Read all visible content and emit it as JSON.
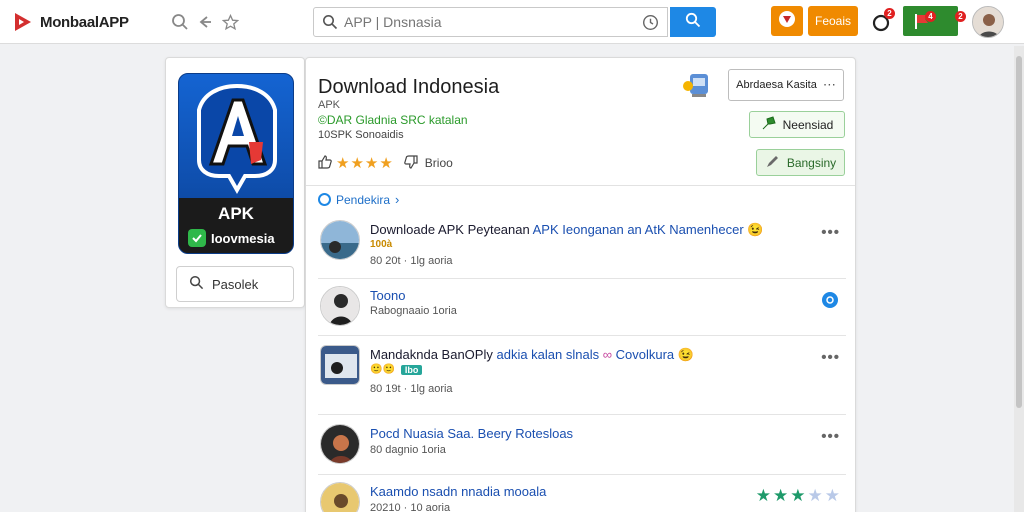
{
  "header": {
    "logo_text": "MonbaalAPP",
    "search_placeholder": "APP | Dnsnasia",
    "orange_button_label": "Feoais",
    "green_badge_count": "4",
    "ring_badge_count": "2",
    "green_badge_count_2": "2"
  },
  "app_card": {
    "icon_label": "APK",
    "icon_sublabel": "Ioovmesia",
    "search_button_label": "Pasolek"
  },
  "app_details": {
    "title": "Download Indonesia",
    "subtitle1": "APK",
    "subtitle2": "©DAR Gladnia SRC katalan",
    "subtitle3": "10SPK Sonoaidis",
    "rating_text": "Brioo",
    "rating_value": 4,
    "actions": {
      "outline_button_label": "Abrdaesa Kasita",
      "green_button_label": "Neensiad",
      "green_button_2_label": "Bangsiny"
    }
  },
  "list_section": {
    "link_label": "Pendekira",
    "items": [
      {
        "title_dark": "Downloade APK Peyteanan",
        "title_blue": "APK Ieonganan an AtK Namenhecer",
        "emoji": "😉",
        "badge": "100à",
        "meta": "80 20t · 1lg aoria"
      },
      {
        "title_dark": "",
        "title_blue": "Toono",
        "emoji": "",
        "badge": "",
        "meta": "Rabognaaio 1oria"
      },
      {
        "title_dark": "Mandaknda BanOPly",
        "title_blue": "adkia kalan slnals",
        "emoji": "😉",
        "badge": "🙂🙂",
        "badge_tag": "Ibo",
        "title_tail": "Covolkura",
        "meta": "80 19t · 1lg aoria"
      },
      {
        "title_dark": "",
        "title_blue": "Pocd Nuasia Saa. Beery Rotesloas",
        "emoji": "",
        "badge": "",
        "meta": "80 dagnio 1oria"
      },
      {
        "title_dark": "",
        "title_blue": "Kaamdo nsadn nnadia mooala",
        "emoji": "",
        "badge": "",
        "meta": "20210 · 10 aoria",
        "rating_value": 3
      }
    ]
  },
  "colors": {
    "brand_red": "#d32f2f",
    "accent_blue": "#1e88e5",
    "accent_orange": "#f08a00",
    "accent_green": "#2e8b2e",
    "star_gold": "#f0a020",
    "star_teal": "#1e9a6a"
  }
}
